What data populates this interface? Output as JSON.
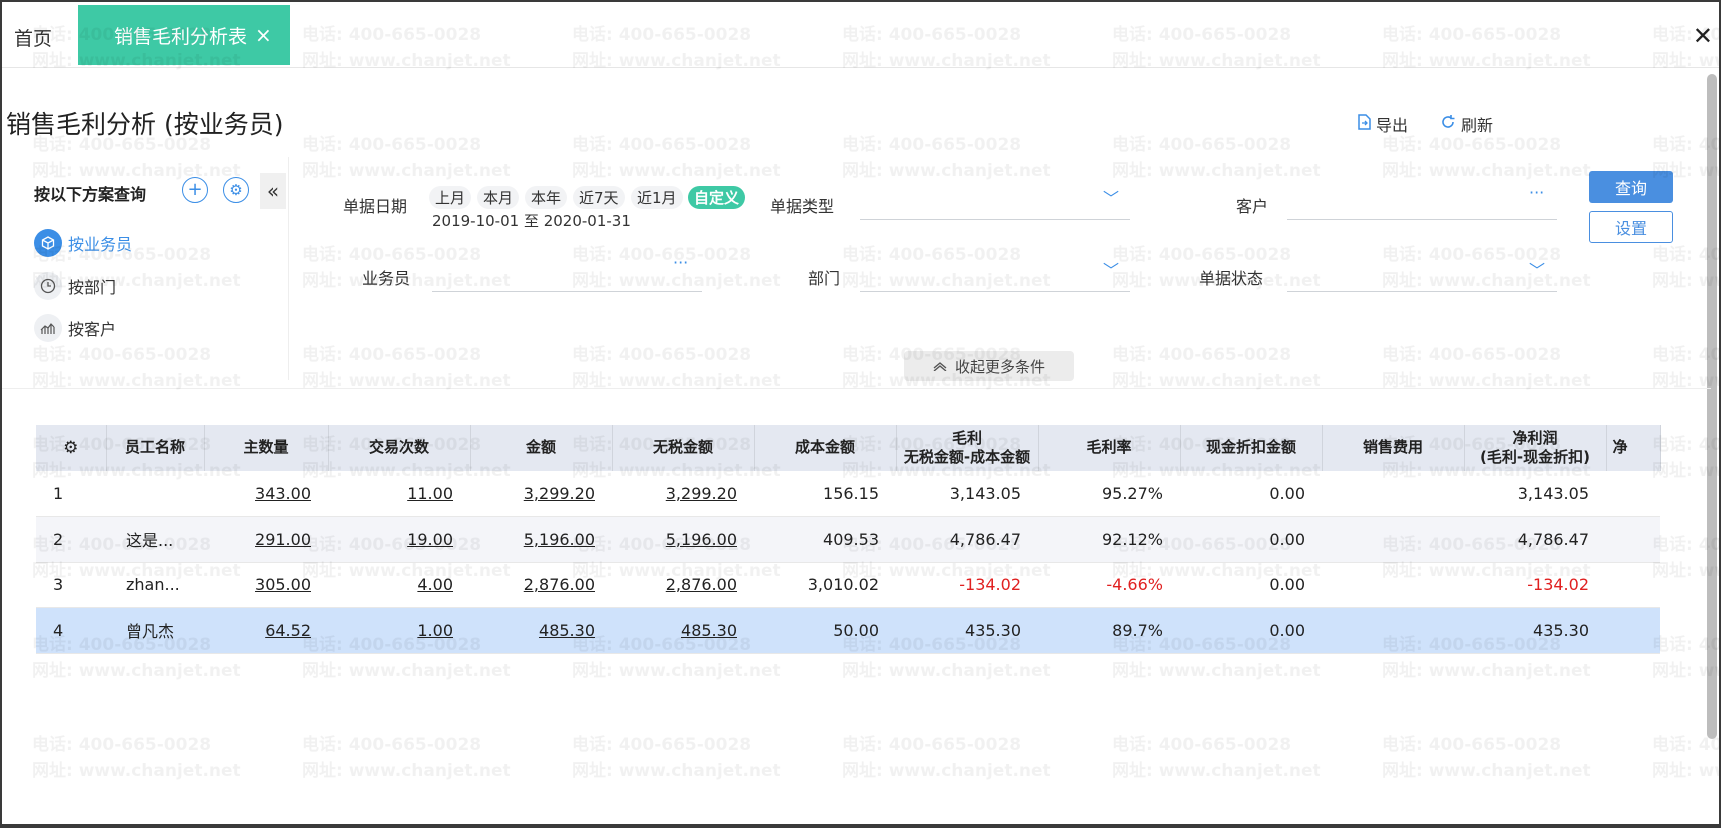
{
  "tabs": {
    "home": "首页",
    "active": "销售毛利分析表",
    "close_glyph": "×",
    "window_close_glyph": "✕"
  },
  "page": {
    "title": "销售毛利分析 (按业务员)",
    "export_label": "导出",
    "refresh_label": "刷新"
  },
  "sidebar": {
    "title": "按以下方案查询",
    "add_glyph": "+",
    "gear_glyph": "⚙",
    "collapse_glyph": "«",
    "schemes": [
      {
        "label": "按业务员",
        "icon": "cube-icon",
        "active": true
      },
      {
        "label": "按部门",
        "icon": "clock-icon",
        "active": false
      },
      {
        "label": "按客户",
        "icon": "chart-icon",
        "active": false
      }
    ]
  },
  "filters": {
    "date_label": "单据日期",
    "date_chips": [
      "上月",
      "本月",
      "本年",
      "近7天",
      "近1月",
      "自定义"
    ],
    "date_range": "2019-10-01 至 2020-01-31",
    "doc_type_label": "单据类型",
    "customer_label": "客户",
    "salesperson_label": "业务员",
    "dept_label": "部门",
    "status_label": "单据状态",
    "ellipsis_glyph": "···",
    "chevron_glyph": "﹀",
    "query_btn": "查询",
    "setting_btn": "设置",
    "more_toggle": "收起更多条件"
  },
  "table": {
    "columns": [
      "",
      "员工名称",
      "主数量",
      "交易次数",
      "金额",
      "无税金额",
      "成本金额",
      "毛利\n无税金额-成本金额",
      "毛利率",
      "现金折扣金额",
      "销售费用",
      "净利润\n(毛利-现金折扣)",
      "净"
    ],
    "header_gear_glyph": "⚙",
    "rows": [
      {
        "idx": "1",
        "name": "",
        "qty": "343.00",
        "count": "11.00",
        "amount": "3,299.20",
        "notax": "3,299.20",
        "cost": "156.15",
        "gross": "3,143.05",
        "rate": "95.27%",
        "discount": "0.00",
        "fee": "",
        "net": "3,143.05"
      },
      {
        "idx": "2",
        "name": "这是...",
        "qty": "291.00",
        "count": "19.00",
        "amount": "5,196.00",
        "notax": "5,196.00",
        "cost": "409.53",
        "gross": "4,786.47",
        "rate": "92.12%",
        "discount": "0.00",
        "fee": "",
        "net": "4,786.47"
      },
      {
        "idx": "3",
        "name": "zhan...",
        "qty": "305.00",
        "count": "4.00",
        "amount": "2,876.00",
        "notax": "2,876.00",
        "cost": "3,010.02",
        "gross": "-134.02",
        "rate": "-4.66%",
        "discount": "0.00",
        "fee": "",
        "net": "-134.02"
      },
      {
        "idx": "4",
        "name": "曾凡杰",
        "qty": "64.52",
        "count": "1.00",
        "amount": "485.30",
        "notax": "485.30",
        "cost": "50.00",
        "gross": "435.30",
        "rate": "89.7%",
        "discount": "0.00",
        "fee": "",
        "net": "435.30"
      }
    ]
  },
  "watermark": {
    "phone": "电话: 400-665-0028",
    "site": "网址: www.chanjet.net"
  },
  "colors": {
    "accent_green": "#3ec9a5",
    "accent_blue": "#4a8fe0",
    "negative": "#e02020",
    "selected_row": "#cfe2fb"
  }
}
